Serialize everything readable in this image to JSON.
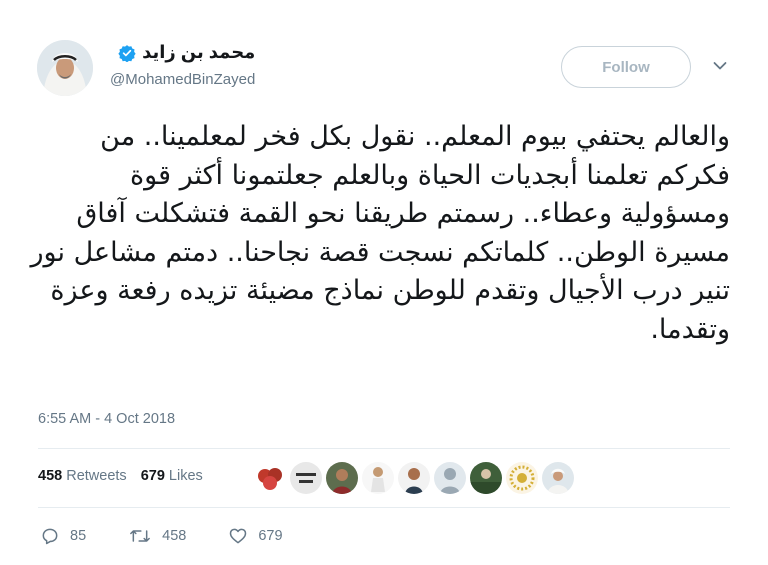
{
  "user": {
    "display_name": "محمد بن زايد",
    "handle": "@MohamedBinZayed"
  },
  "follow_label": "Follow",
  "tweet_text": "والعالم يحتفي بيوم المعلم.. نقول بكل فخر لمعلمينا.. من فكركم تعلمنا أبجديات الحياة وبالعلم جعلتمونا أكثر قوة ومسؤولية وعطاء.. رسمتم طريقنا نحو القمة فتشكلت آفاق مسيرة الوطن.. كلماتكم نسجت قصة نجاحنا.. دمتم مشاعل نور تنير درب الأجيال وتقدم للوطن نماذج مضيئة تزيده رفعة وعزة وتقدما.",
  "timestamp": "6:55 AM - 4 Oct 2018",
  "stats": {
    "retweets_count": "458",
    "retweets_label": "Retweets",
    "likes_count": "679",
    "likes_label": "Likes"
  },
  "actions": {
    "replies": "85",
    "retweets": "458",
    "likes": "679"
  },
  "colors": {
    "verified": "#1da1f2",
    "muted": "#657786",
    "text": "#14171a",
    "divider": "#e6ecf0"
  },
  "icons": [
    "verified-badge-icon",
    "chevron-down-icon",
    "reply-icon",
    "retweet-icon",
    "heart-icon"
  ]
}
